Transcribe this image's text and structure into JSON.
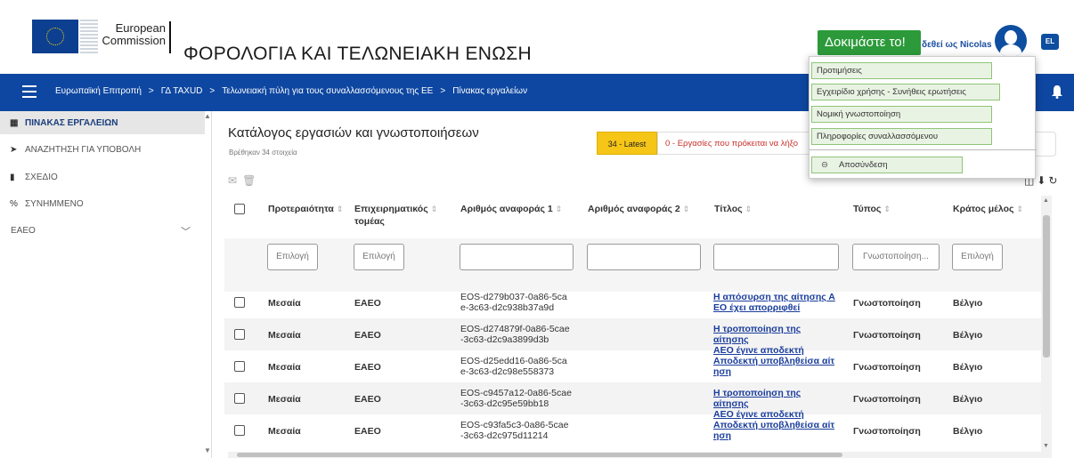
{
  "header": {
    "ec_line1": "European",
    "ec_line2": "Commission",
    "site_title": "ΦΟΡΟΛΟΓΙΑ ΚΑΙ ΤΕΛΩΝΕΙΑΚΗ ΕΝΩΣΗ",
    "try_button": "Δοκιμάστε το!",
    "user_text": "δεθεί ως Nicolas",
    "language": "EL"
  },
  "breadcrumb": {
    "items": [
      "Ευρωπαϊκή Επιτροπή",
      "ΓΔ TAXUD",
      "Τελωνειακή πύλη για τους συναλλασσόμενους της ΕΕ",
      "Πίνακας εργαλείων"
    ],
    "separator": ">"
  },
  "sidebar": {
    "items": [
      {
        "label": "ΠΙΝΑΚΑΣ ΕΡΓΑΛΕΙΩΝ",
        "icon": "dashboard-icon"
      },
      {
        "label": "ΑΝΑΖΗΤΗΣΗ ΓΙΑ ΥΠΟΒΟΛΗ",
        "icon": "send-icon"
      },
      {
        "label": "ΣΧΕΔΙΟ",
        "icon": "document-icon"
      },
      {
        "label": "ΣΥΝΗΜΜΕΝΟ",
        "icon": "attachment-icon"
      },
      {
        "label": "EAEO",
        "icon": "chevron-down-icon"
      }
    ]
  },
  "main": {
    "title": "Κατάλογος εργασιών και γνωστοποιήσεων",
    "subtitle": "Βρέθηκαν 34 στοιχεία",
    "tab_latest": "34 - Latest",
    "tab_tasks": "0 - Εργασίες που πρόκειται να λήξο"
  },
  "table": {
    "headers": {
      "priority": "Προτεραιότητα",
      "sector_1": "Επιχειρηματικός",
      "sector_2": "τομέας",
      "ref1": "Αριθμός αναφοράς 1",
      "ref2": "Αριθμός αναφοράς 2",
      "title": "Τίτλος",
      "type": "Τύπος",
      "member_state": "Κράτος μέλος"
    },
    "sort_glyph": "⇕",
    "filters": {
      "priority": "Επιλογή",
      "sector": "Επιλογή",
      "type": "Γνωστοποίηση...",
      "member_state": "Επιλογή"
    },
    "rows": [
      {
        "priority": "Μεσαία",
        "sector": "EAEO",
        "ref1_a": "EOS-d279b037-0a86-5ca",
        "ref1_b": "e-3c63-d2c938b37a9d",
        "title_a": "Η απόσυρση της αίτησης Α",
        "title_b": "ΕΟ έχει απορριφθεί",
        "type": "Γνωστοποίηση",
        "member_state": "Βέλγιο"
      },
      {
        "priority": "Μεσαία",
        "sector": "EAEO",
        "ref1_a": "EOS-d274879f-0a86-5cae",
        "ref1_b": "-3c63-d2c9a3899d3b",
        "title_a": "Η τροποποίηση της αίτησης",
        "title_b": "ΑΕΟ έγινε αποδεκτή",
        "type": "Γνωστοποίηση",
        "member_state": "Βέλγιο"
      },
      {
        "priority": "Μεσαία",
        "sector": "EAEO",
        "ref1_a": "EOS-d25edd16-0a86-5ca",
        "ref1_b": "e-3c63-d2c98e558373",
        "title_a": "Αποδεκτή υποβληθείσα αίτ",
        "title_b": "ηση",
        "type": "Γνωστοποίηση",
        "member_state": "Βέλγιο"
      },
      {
        "priority": "Μεσαία",
        "sector": "EAEO",
        "ref1_a": "EOS-c9457a12-0a86-5cae",
        "ref1_b": "-3c63-d2c95e59bb18",
        "title_a": "Η τροποποίηση της αίτησης",
        "title_b": "ΑΕΟ έγινε αποδεκτή",
        "type": "Γνωστοποίηση",
        "member_state": "Βέλγιο"
      },
      {
        "priority": "Μεσαία",
        "sector": "EAEO",
        "ref1_a": "EOS-c93fa5c3-0a86-5cae",
        "ref1_b": "-3c63-d2c975d11214",
        "title_a": "Αποδεκτή υποβληθείσα αίτ",
        "title_b": "ηση",
        "type": "Γνωστοποίηση",
        "member_state": "Βέλγιο"
      }
    ]
  },
  "dropdown": {
    "items": [
      "Προτιμήσεις",
      "Εγχειρίδιο χρήσης - Συνήθεις ερωτήσεις",
      "Νομική γνωστοποίηση",
      "Πληροφορίες συναλλασσόμενου"
    ],
    "logout": "Αποσύνδεση"
  },
  "colors": {
    "brand_blue": "#0e47a1",
    "try_green": "#2c9a3a",
    "latest_yellow": "#f5c518",
    "tasks_red": "#c9302c",
    "link_blue": "#1a3d9c"
  }
}
